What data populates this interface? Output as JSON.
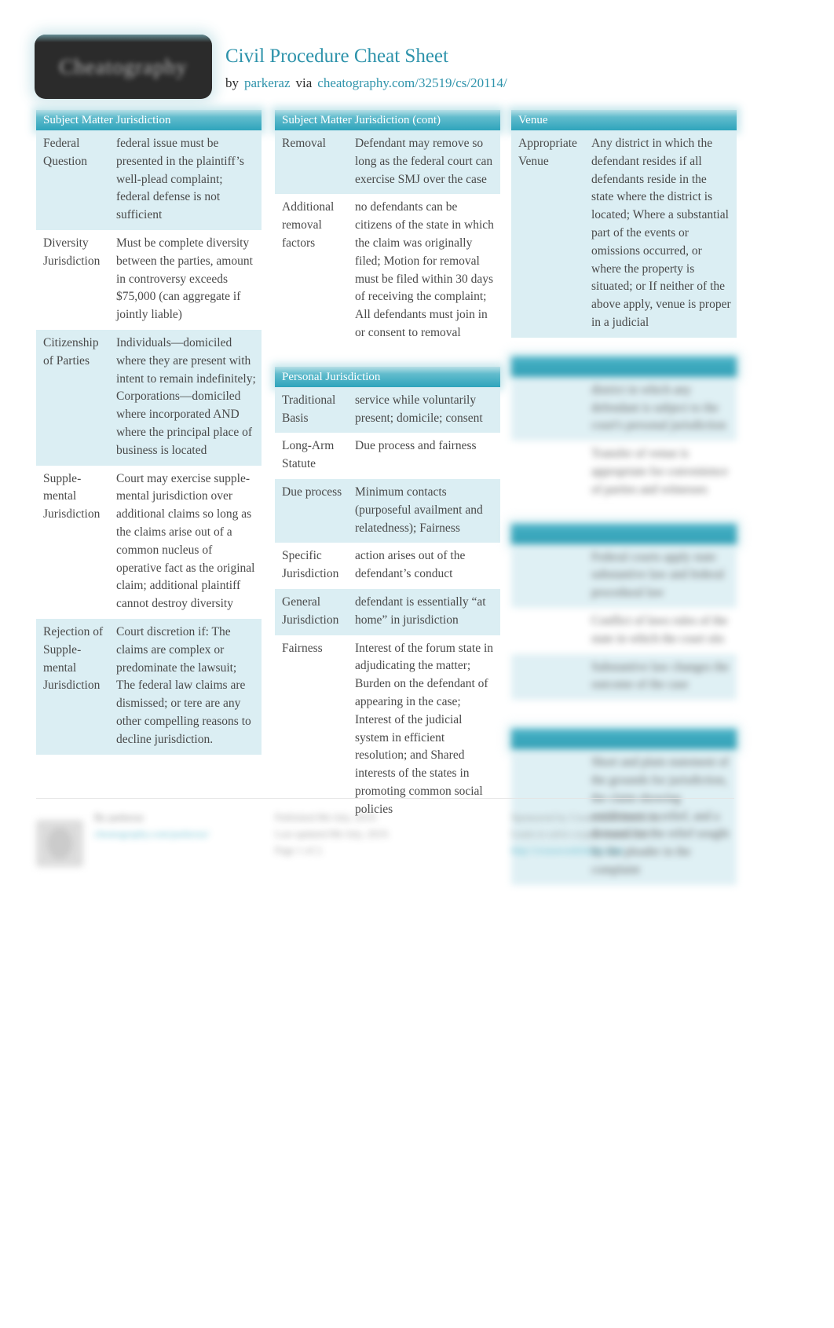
{
  "header": {
    "logo_text": "Cheatography",
    "title": "Civil Procedure Cheat Sheet",
    "by_label": "by",
    "author": "parkeraz",
    "via_label": "via",
    "source_url": "cheatography.com/32519/cs/20114/"
  },
  "columns": [
    {
      "blocks": [
        {
          "title": "Subject Matter Jurisdiction",
          "blurred": false,
          "rows": [
            {
              "key": "Federal Question",
              "value": "federal issue must be presented in the plaintiff’s well-plead complaint; federal defense is not sufficient"
            },
            {
              "key": "Diversity Jurisd­iction",
              "value": "Must be complete diversity between the parties, amount in controversy exceeds $75,000 (can aggregate if jointly liable)"
            },
            {
              "key": "Citize­nship of Parties",
              "value": "Individuals—domiciled where they are present with intent to remain indefinitely; Corporat­ions—domiciled where incorp­orated AND where the principal place of business is located"
            },
            {
              "key": "Supple­mental Jurisd­iction",
              "value": "Court may exercise supple­mental jurisdiction over additional claims so long as the claims arise out of a common nucleus of operative fact as the original claim; additional plaintiff cannot destroy diversity"
            },
            {
              "key": "Rejection of Supple­mental Jurisd­iction",
              "value": "Court discretion if: The claims are complex or predominate the lawsuit; The federal law claims are dismissed; or tere are any other compelling reasons to decline jurisdiction."
            }
          ]
        }
      ]
    },
    {
      "blocks": [
        {
          "title": "Subject Matter Jurisdiction (cont)",
          "blurred": false,
          "rows": [
            {
              "key": "Removal",
              "value": "Defendant may remove so long as the federal court can exercise SMJ over the case"
            },
            {
              "key": "Additional removal factors",
              "value": "no defendants can be citizens of the state in which the claim was originally filed; Motion for removal must be filed within 30 days of receiving the complaint; All defendants must join in or consent to removal"
            }
          ]
        },
        {
          "title": "Personal Jurisdiction",
          "blurred": false,
          "rows": [
            {
              "key": "Tradit­ional Basis",
              "value": "service while voluntarily present; domicile; consent"
            },
            {
              "key": "Long-Arm Statute",
              "value": "Due process and fairness"
            },
            {
              "key": "Due process",
              "value": "Minimum contacts (purposeful availment and relatedness); Fairness"
            },
            {
              "key": "Specific Jurisd­iction",
              "value": "action arises out of the defend­ant’s conduct"
            },
            {
              "key": "General Jurisd­iction",
              "value": "defendant is essentially “at home” in jurisdiction"
            },
            {
              "key": "Fairness",
              "value": "Interest of the forum state in adjudicating the matter; Burden on the defendant of appearing in the case; Interest of the judicial system in efficient resolution; and Shared interests of the states in promoting common social policies"
            }
          ]
        }
      ]
    },
    {
      "blocks": [
        {
          "title": "Venue",
          "blurred": false,
          "rows": [
            {
              "key": "Approp­riate Venue",
              "value": "Any district in which the defendant resides if all defendants reside in the state where the district is located; Where a substantial part of the events or omissions occurred, or where the property is situated; or If neither of the above apply, venue is proper in a judicial"
            }
          ]
        },
        {
          "title": "",
          "blurred": true,
          "rows": [
            {
              "key": "",
              "value": "district in which any defendant is subject to the court's personal jurisdiction"
            },
            {
              "key": "",
              "value": "Transfer of venue is appropriate for convenience of parties and witnesses"
            }
          ]
        },
        {
          "title": "",
          "blurred": true,
          "rows": [
            {
              "key": "",
              "value": "Federal courts apply state substantive law and federal procedural law"
            },
            {
              "key": "",
              "value": "Conflict of laws rules of the state in which the court sits"
            },
            {
              "key": "",
              "value": "Substantive law changes the outcome of the case"
            },
            {
              "key": "",
              "value": ""
            }
          ]
        },
        {
          "title": "",
          "blurred": true,
          "rows": [
            {
              "key": "",
              "value": "Short and plain statement of the grounds for jurisdiction, the claim showing entitlement to relief, and a demand for the relief sought by the pleader in the complaint"
            }
          ]
        }
      ]
    }
  ],
  "footer": {
    "left": {
      "line1": "By parkeraz",
      "line2": "cheatography.com/parkeraz/"
    },
    "middle": {
      "line1": "Published 8th July, 2019.",
      "line2": "Last updated 8th July, 2019.",
      "line3": "Page 1 of 2."
    },
    "right": {
      "line1": "Sponsored by CrosswordCheats.com",
      "line2": "Learn to solve cryptic crosswords!",
      "line3": "http://crosswordcheats.com"
    }
  },
  "colors": {
    "accent": "#2e93ab",
    "header_bar": "#2ea4bc",
    "row_alt": "#dbeef3",
    "link": "#4fb3c8"
  }
}
